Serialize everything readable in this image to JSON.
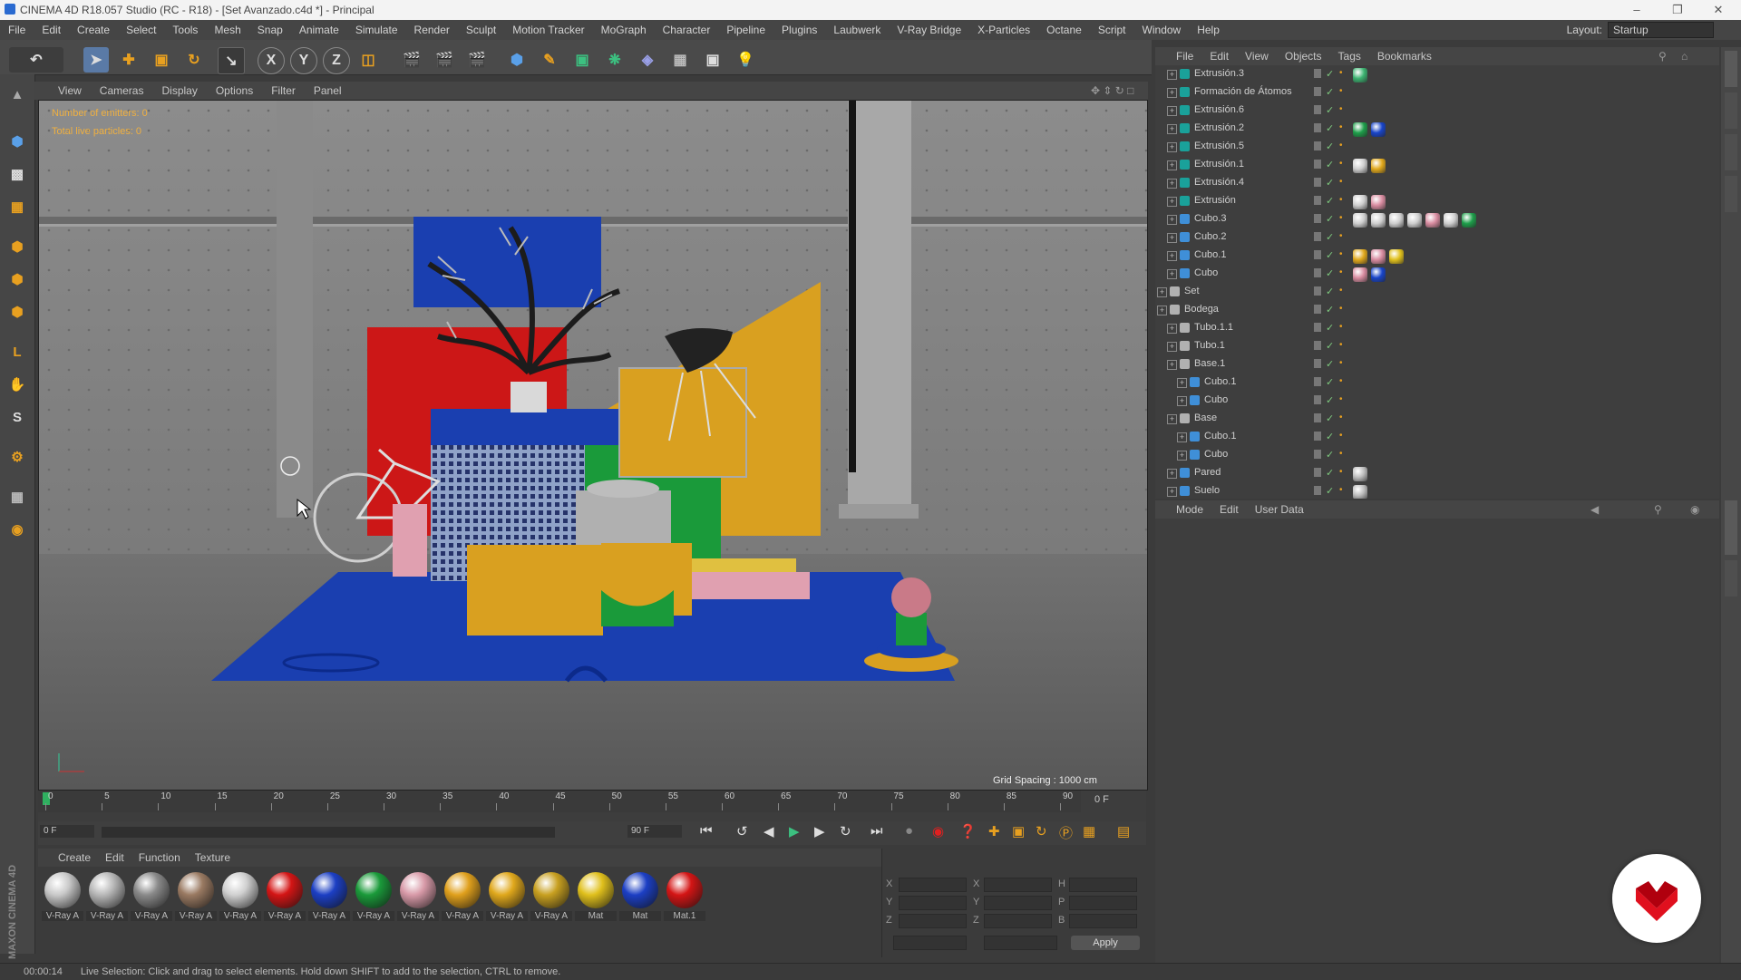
{
  "window": {
    "title": "CINEMA 4D R18.057 Studio (RC - R18) - [Set Avanzado.c4d *] - Principal"
  },
  "menu": [
    "File",
    "Edit",
    "Create",
    "Select",
    "Tools",
    "Mesh",
    "Snap",
    "Animate",
    "Simulate",
    "Render",
    "Sculpt",
    "Motion Tracker",
    "MoGraph",
    "Character",
    "Pipeline",
    "Plugins",
    "Laubwerk",
    "V-Ray Bridge",
    "X-Particles",
    "Octane",
    "Script",
    "Window",
    "Help"
  ],
  "layout": {
    "label": "Layout:",
    "value": "Startup"
  },
  "viewport": {
    "menu": [
      "View",
      "Cameras",
      "Display",
      "Options",
      "Filter",
      "Panel"
    ],
    "hud_emitters": "Number of emitters: 0",
    "hud_particles": "Total live particles: 0",
    "grid_spacing": "Grid Spacing : 1000 cm"
  },
  "timeline": {
    "ticks": [
      "0",
      "5",
      "10",
      "15",
      "20",
      "25",
      "30",
      "35",
      "40",
      "45",
      "50",
      "55",
      "60",
      "65",
      "70",
      "75",
      "80",
      "85",
      "90"
    ],
    "end_frame": "0 F",
    "current": "0 F",
    "max": "90 F"
  },
  "objects": {
    "menu": [
      "File",
      "Edit",
      "View",
      "Objects",
      "Tags",
      "Bookmarks"
    ],
    "rows": [
      {
        "name": "Extrusión.3",
        "indent": 1,
        "icon": "#1aa19a",
        "tags": [
          "#3cb371"
        ]
      },
      {
        "name": "Formación de Átomos",
        "indent": 1,
        "icon": "#1aa19a",
        "tags": []
      },
      {
        "name": "Extrusión.6",
        "indent": 1,
        "icon": "#1aa19a",
        "tags": []
      },
      {
        "name": "Extrusión.2",
        "indent": 1,
        "icon": "#1aa19a",
        "tags": [
          "#1e9e4a",
          "#1844c8"
        ]
      },
      {
        "name": "Extrusión.5",
        "indent": 1,
        "icon": "#1aa19a",
        "tags": []
      },
      {
        "name": "Extrusión.1",
        "indent": 1,
        "icon": "#1aa19a",
        "tags": [
          "#cfcfcf",
          "#e0a81c"
        ]
      },
      {
        "name": "Extrusión.4",
        "indent": 1,
        "icon": "#1aa19a",
        "tags": []
      },
      {
        "name": "Extrusión",
        "indent": 1,
        "icon": "#1aa19a",
        "tags": [
          "#cfcfcf",
          "#d88ca0"
        ]
      },
      {
        "name": "Cubo.3",
        "indent": 1,
        "icon": "#3f8fd8",
        "tags": [
          "#cfcfcf",
          "#cfcfcf",
          "#cfcfcf",
          "#cfcfcf",
          "#d88ca0",
          "#cfcfcf",
          "#1e9e4a"
        ]
      },
      {
        "name": "Cubo.2",
        "indent": 1,
        "icon": "#3f8fd8",
        "tags": []
      },
      {
        "name": "Cubo.1",
        "indent": 1,
        "icon": "#3f8fd8",
        "tags": [
          "#e0a81c",
          "#d88ca0",
          "#e0c01c"
        ]
      },
      {
        "name": "Cubo",
        "indent": 1,
        "icon": "#3f8fd8",
        "tags": [
          "#d88ca0",
          "#1844c8"
        ]
      },
      {
        "name": "Set",
        "indent": 0,
        "icon": "#b0b0b0",
        "tags": []
      },
      {
        "name": "Bodega",
        "indent": 0,
        "icon": "#b0b0b0",
        "tags": []
      },
      {
        "name": "Tubo.1.1",
        "indent": 1,
        "icon": "#b0b0b0",
        "tags": []
      },
      {
        "name": "Tubo.1",
        "indent": 1,
        "icon": "#b0b0b0",
        "tags": []
      },
      {
        "name": "Base.1",
        "indent": 1,
        "icon": "#b0b0b0",
        "tags": []
      },
      {
        "name": "Cubo.1",
        "indent": 2,
        "icon": "#3f8fd8",
        "tags": []
      },
      {
        "name": "Cubo",
        "indent": 2,
        "icon": "#3f8fd8",
        "tags": []
      },
      {
        "name": "Base",
        "indent": 1,
        "icon": "#b0b0b0",
        "tags": []
      },
      {
        "name": "Cubo.1",
        "indent": 2,
        "icon": "#3f8fd8",
        "tags": []
      },
      {
        "name": "Cubo",
        "indent": 2,
        "icon": "#3f8fd8",
        "tags": []
      },
      {
        "name": "Pared",
        "indent": 1,
        "icon": "#3f8fd8",
        "tags": [
          "#bdbdbd"
        ]
      },
      {
        "name": "Suelo",
        "indent": 1,
        "icon": "#3f8fd8",
        "tags": [
          "#bdbdbd"
        ]
      }
    ]
  },
  "attributes": {
    "menu": [
      "Mode",
      "Edit",
      "User Data"
    ]
  },
  "materials": {
    "menu": [
      "Create",
      "Edit",
      "Function",
      "Texture"
    ],
    "items": [
      {
        "label": "V-Ray A",
        "color": "#c9c9c9"
      },
      {
        "label": "V-Ray A",
        "color": "#b8b8b8"
      },
      {
        "label": "V-Ray A",
        "color": "#8a8a8a"
      },
      {
        "label": "V-Ray A",
        "color": "#9a7a62"
      },
      {
        "label": "V-Ray A",
        "color": "#d0d0d0"
      },
      {
        "label": "V-Ray A",
        "color": "#d41515"
      },
      {
        "label": "V-Ray A",
        "color": "#1c3fc4"
      },
      {
        "label": "V-Ray A",
        "color": "#1a9a3a"
      },
      {
        "label": "V-Ray A",
        "color": "#d89aa8"
      },
      {
        "label": "V-Ray A",
        "color": "#e0a01c"
      },
      {
        "label": "V-Ray A",
        "color": "#e0a81c"
      },
      {
        "label": "V-Ray A",
        "color": "#c8a020"
      },
      {
        "label": "Mat",
        "color": "#e0c01c"
      },
      {
        "label": "Mat",
        "color": "#1c3fc4"
      },
      {
        "label": "Mat.1",
        "color": "#d41515"
      }
    ]
  },
  "coords": {
    "apply": "Apply",
    "x": "X",
    "y": "Y",
    "z": "Z",
    "h": "H",
    "p": "P",
    "b": "B"
  },
  "status": {
    "time": "00:00:14",
    "message": "Live Selection: Click and drag to select elements. Hold down SHIFT to add to the selection, CTRL to remove."
  },
  "side_logo": "MAXON CINEMA 4D",
  "colors": {
    "accent": "#e0a81c",
    "hud": "#f0b040",
    "brand": "#e0101e"
  }
}
